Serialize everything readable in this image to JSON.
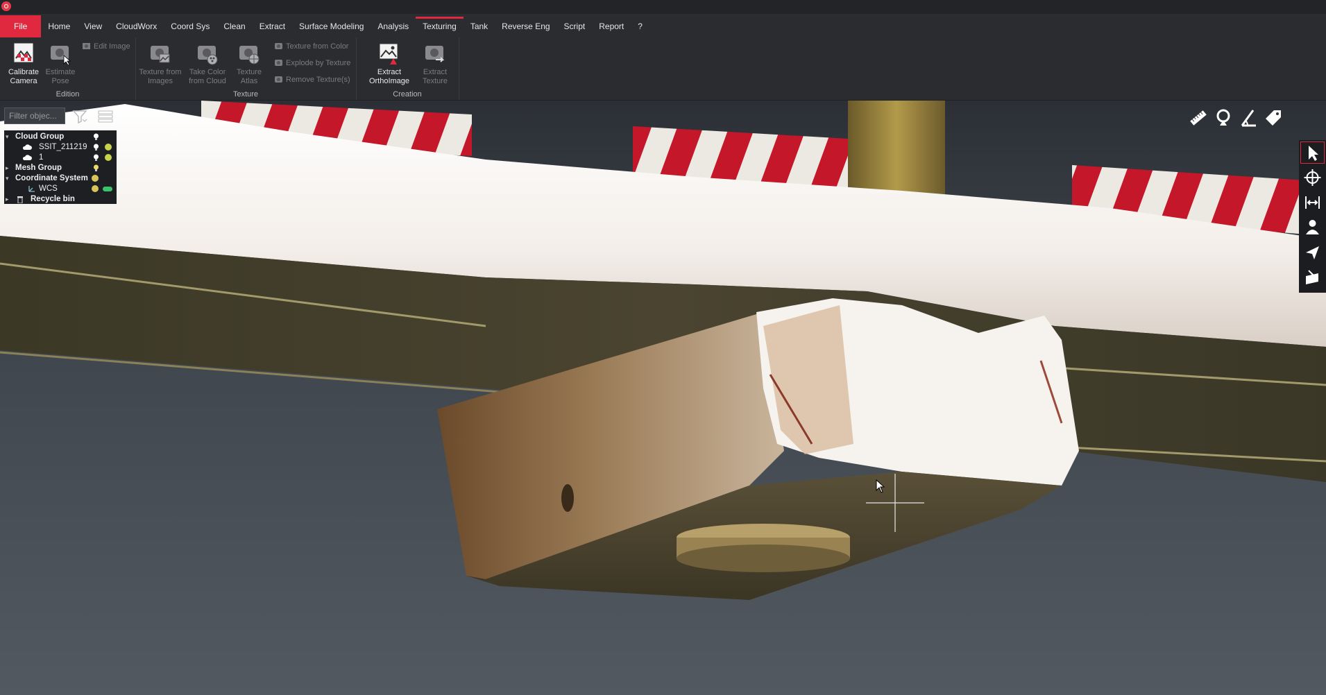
{
  "menu": {
    "tabs": [
      "File",
      "Home",
      "View",
      "CloudWorx",
      "Coord Sys",
      "Clean",
      "Extract",
      "Surface Modeling",
      "Analysis",
      "Texturing",
      "Tank",
      "Reverse Eng",
      "Script",
      "Report",
      "?"
    ],
    "active": "Texturing"
  },
  "ribbon": {
    "edition": {
      "label": "Edition",
      "calibrate_camera": "Calibrate\nCamera",
      "estimate_pose": "Estimate\nPose",
      "edit_image": "Edit Image"
    },
    "texture": {
      "label": "Texture",
      "texture_from_images": "Texture from\nImages",
      "take_color_from_cloud": "Take Color\nfrom Cloud",
      "texture_atlas": "Texture\nAtlas",
      "texture_from_color": "Texture from Color",
      "explode_by_texture": "Explode by Texture",
      "remove_textures": "Remove Texture(s)"
    },
    "creation": {
      "label": "Creation",
      "extract_orthoimage": "Extract\nOrthoImage",
      "extract_texture": "Extract\nTexture"
    }
  },
  "filter": {
    "placeholder": "Filter objec..."
  },
  "tree": {
    "cloud_group": "Cloud Group",
    "cloud_1": "SSIT_211219",
    "cloud_2": "1",
    "mesh_group": "Mesh Group",
    "coordinate_system": "Coordinate System",
    "wcs": "WCS",
    "recycle_bin": "Recycle bin"
  },
  "colors": {
    "accent": "#e0283f",
    "background_viewport": "#4a5159",
    "ribbon_bg": "#2b2c2f"
  },
  "icons": {
    "measure_tools": [
      "ruler-icon",
      "pin-measure-icon",
      "angle-measure-icon",
      "tag-icon"
    ],
    "side_toolbar": [
      "select-arrow-icon",
      "orbit-icon",
      "fit-view-icon",
      "walk-mode-icon",
      "fly-mode-icon",
      "clipping-box-icon"
    ]
  }
}
